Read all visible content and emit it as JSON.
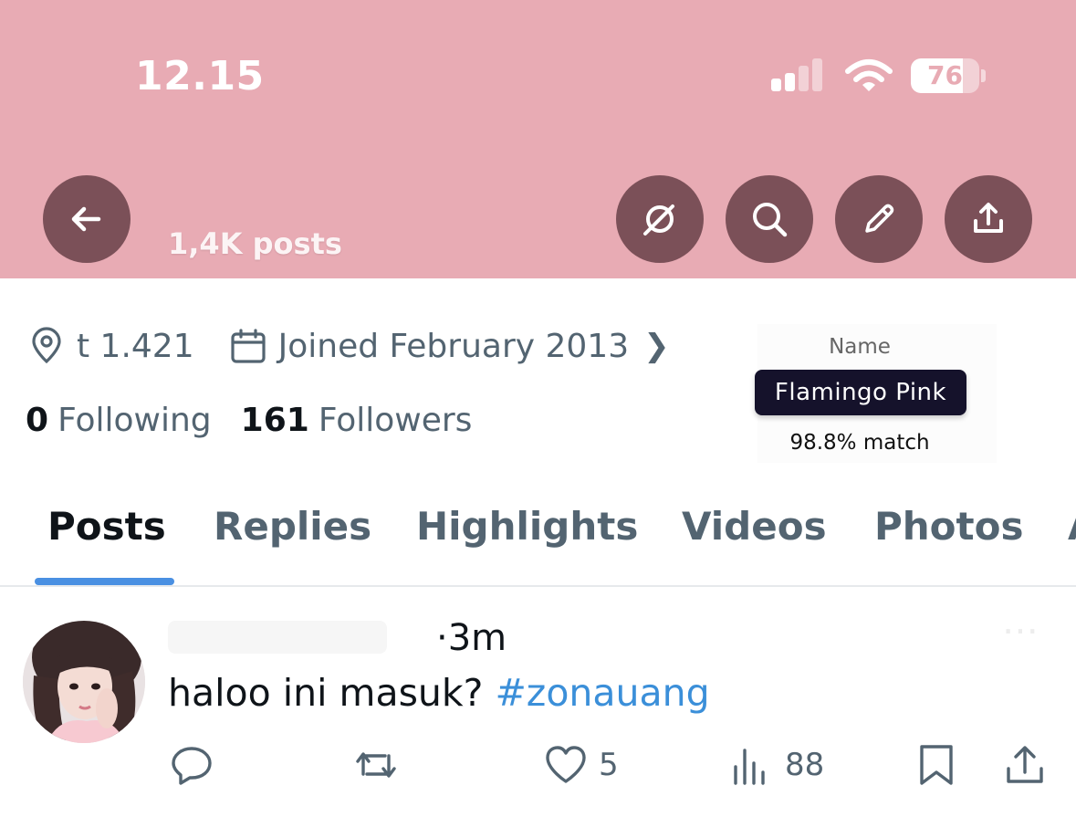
{
  "colors": {
    "header_bg": "#e8abb4",
    "header_button_bg": "#7b5058",
    "accent_blue": "#4a90e2",
    "hashtag_blue": "#3b8fd9",
    "text_primary": "#0f1419",
    "text_secondary": "#536471",
    "tooltip_bg": "#15122b"
  },
  "status_bar": {
    "time": "12.15",
    "battery_level": 76,
    "battery_label": "76",
    "signal_bars": 2,
    "icons": [
      "signal-icon",
      "wifi-icon",
      "battery-icon"
    ]
  },
  "header": {
    "posts_count": "1,4K posts",
    "buttons": [
      {
        "name": "back-button",
        "icon": "arrow-left-icon"
      },
      {
        "name": "grok-button",
        "icon": "slash-circle-icon"
      },
      {
        "name": "search-button",
        "icon": "search-icon"
      },
      {
        "name": "edit-button",
        "icon": "pencil-icon"
      },
      {
        "name": "share-button",
        "icon": "share-icon"
      }
    ]
  },
  "profile": {
    "location": "t 1.421",
    "joined": "Joined February 2013",
    "following_count": "0",
    "following_label": "Following",
    "followers_count": "161",
    "followers_label": "Followers"
  },
  "color_card": {
    "title": "Name",
    "color_name": "Flamingo Pink",
    "match": "98.8% match"
  },
  "tabs": [
    {
      "label": "Posts",
      "active": true
    },
    {
      "label": "Replies",
      "active": false
    },
    {
      "label": "Highlights",
      "active": false
    },
    {
      "label": "Videos",
      "active": false
    },
    {
      "label": "Photos",
      "active": false
    },
    {
      "label": "A",
      "active": false
    }
  ],
  "post": {
    "time": "·3m",
    "text": "haloo ini masuk? ",
    "hashtag": "#zonauang",
    "actions": {
      "reply_count": "",
      "repost_count": "",
      "like_count": "5",
      "views_count": "88"
    }
  }
}
